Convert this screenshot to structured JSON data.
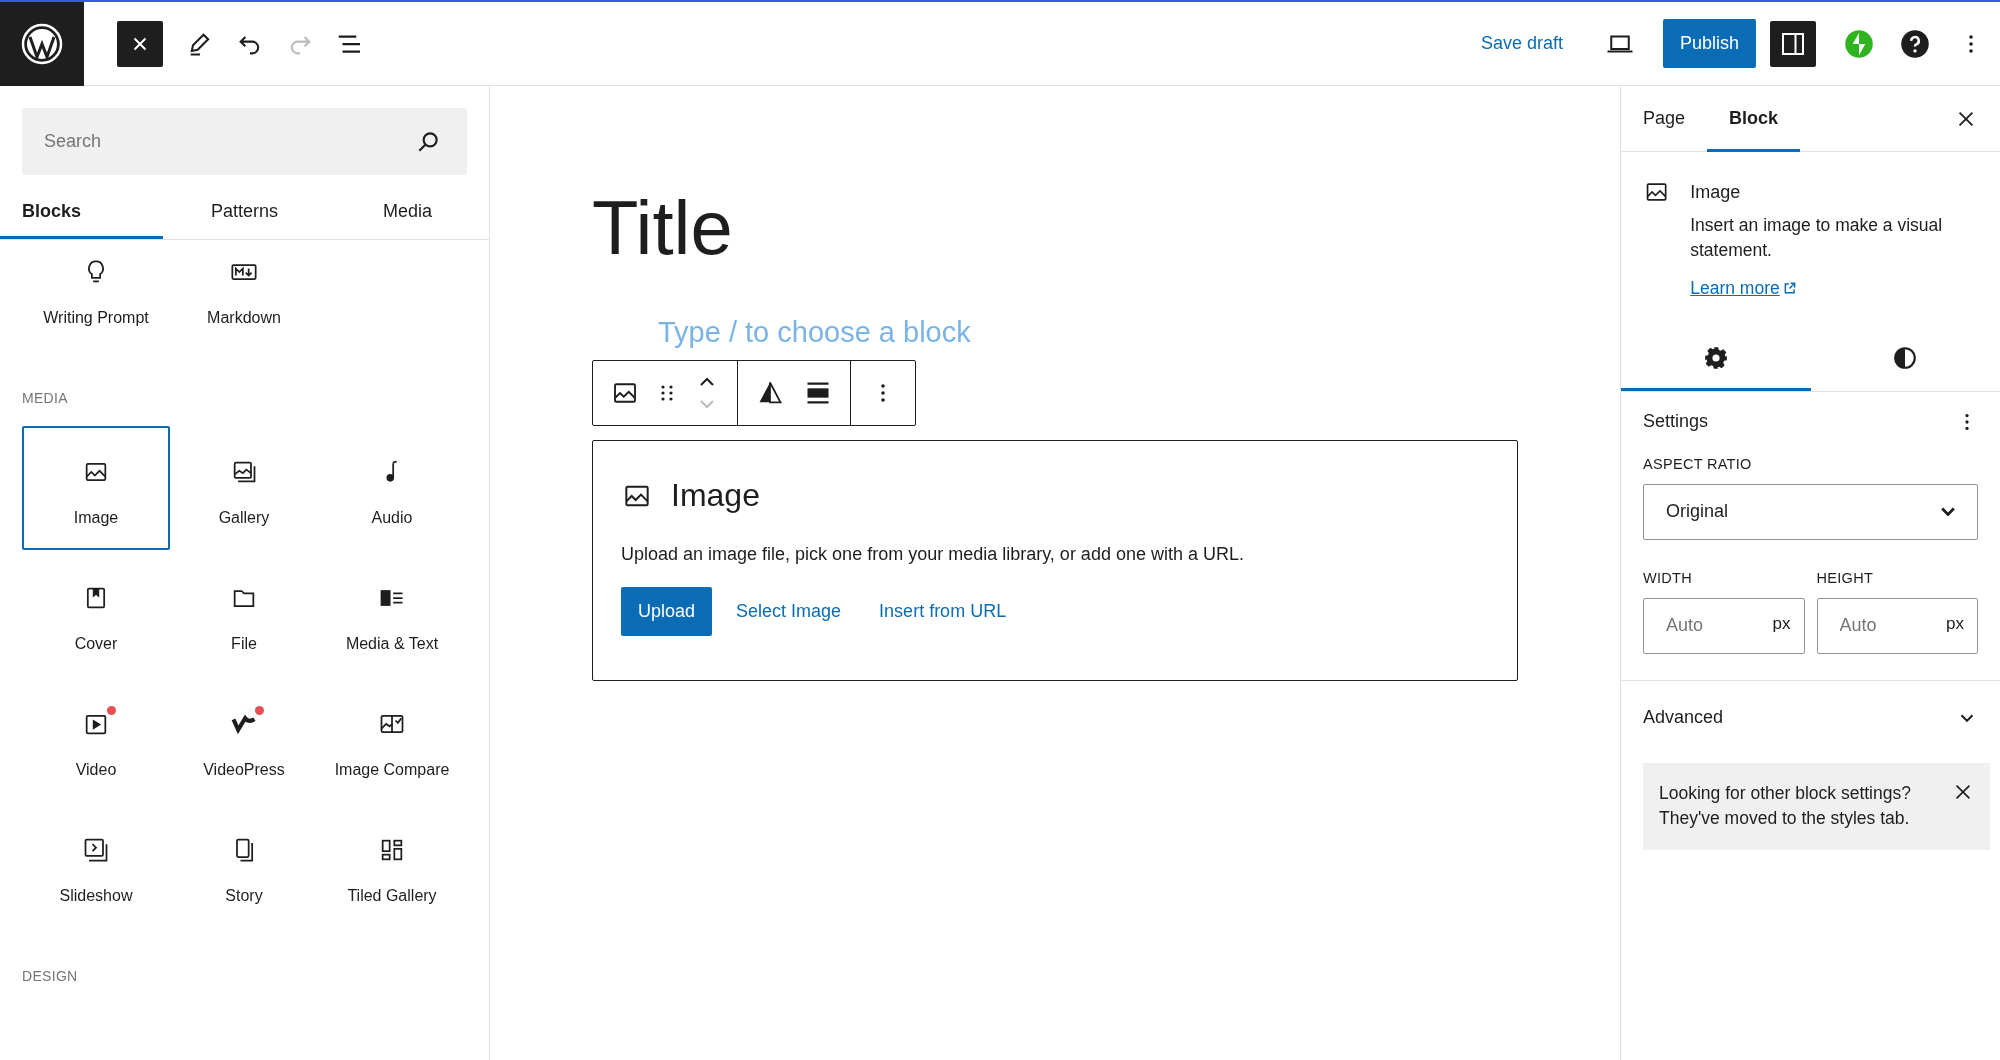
{
  "top_bar": {
    "save_draft": "Save draft",
    "publish": "Publish",
    "settings_toggle": {
      "on": true
    }
  },
  "inserter": {
    "search": {
      "placeholder": "Search"
    },
    "tabs": [
      {
        "label": "Blocks",
        "selected": true
      },
      {
        "label": "Patterns",
        "selected": false
      },
      {
        "label": "Media",
        "selected": false
      }
    ],
    "sections": [
      {
        "blocks": [
          {
            "label": "Writing Prompt",
            "selected": false,
            "new_badge": false
          },
          {
            "label": "Markdown",
            "selected": false,
            "new_badge": false
          }
        ]
      },
      {
        "heading": "MEDIA",
        "blocks": [
          {
            "label": "Image",
            "selected": true,
            "new_badge": false
          },
          {
            "label": "Gallery",
            "selected": false,
            "new_badge": false
          },
          {
            "label": "Audio",
            "selected": false,
            "new_badge": false
          },
          {
            "label": "Cover",
            "selected": false,
            "new_badge": false
          },
          {
            "label": "File",
            "selected": false,
            "new_badge": false
          },
          {
            "label": "Media & Text",
            "selected": false,
            "new_badge": false
          },
          {
            "label": "Video",
            "selected": false,
            "new_badge": true
          },
          {
            "label": "VideoPress",
            "selected": false,
            "new_badge": true
          },
          {
            "label": "Image Compare",
            "selected": false,
            "new_badge": false
          },
          {
            "label": "Slideshow",
            "selected": false,
            "new_badge": false
          },
          {
            "label": "Story",
            "selected": false,
            "new_badge": false
          },
          {
            "label": "Tiled Gallery",
            "selected": false,
            "new_badge": false
          }
        ]
      },
      {
        "heading": "DESIGN"
      }
    ]
  },
  "editor": {
    "title": "Title",
    "placeholder": "Type / to choose a block",
    "image_block": {
      "title": "Image",
      "instructions": "Upload an image file, pick one from your media library, or add one with a URL.",
      "upload": "Upload",
      "select_image": "Select Image",
      "insert_from_url": "Insert from URL"
    }
  },
  "sidebar": {
    "tabs": [
      {
        "label": "Page",
        "selected": false
      },
      {
        "label": "Block",
        "selected": true
      }
    ],
    "block_card": {
      "title": "Image",
      "description": "Insert an image to make a visual statement.",
      "link": "Learn more"
    },
    "panel_tabs": [
      {
        "selected": true
      },
      {
        "selected": false
      }
    ],
    "settings": {
      "title": "Settings",
      "aspect_ratio": {
        "label": "ASPECT RATIO",
        "value": "Original"
      },
      "width": {
        "label": "WIDTH",
        "placeholder": "Auto",
        "unit": "px"
      },
      "height": {
        "label": "HEIGHT",
        "placeholder": "Auto",
        "unit": "px"
      }
    },
    "advanced": {
      "title": "Advanced",
      "expanded": false
    },
    "notice": "Looking for other block settings? They've moved to the styles tab."
  }
}
